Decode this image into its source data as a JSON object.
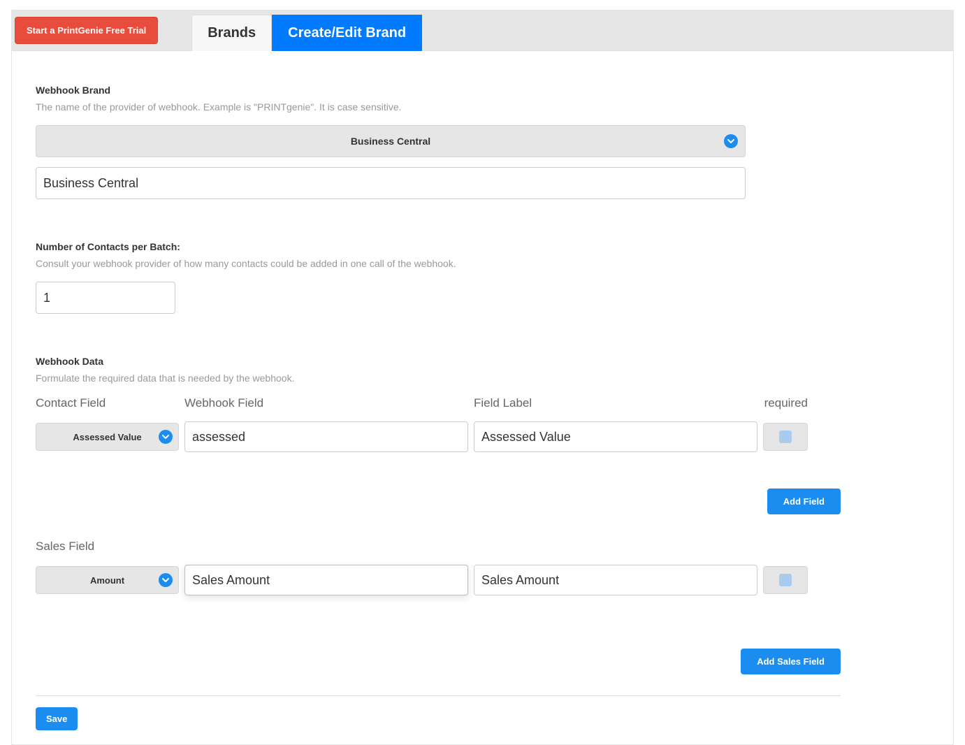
{
  "topbar": {
    "trial_label": "Start a PrintGenie Free Trial",
    "tabs": {
      "brands": "Brands",
      "create_edit": "Create/Edit Brand"
    }
  },
  "sections": {
    "webhook_brand": {
      "title": "Webhook Brand",
      "subtitle": "The name of the provider of webhook. Example is \"PRINTgenie\". It is case sensitive.",
      "select_value": "Business Central",
      "input_value": "Business Central"
    },
    "contacts": {
      "title": "Number of Contacts per Batch:",
      "subtitle": "Consult your webhook provider of how many contacts could be added in one call of the webhook.",
      "value": "1"
    },
    "webhook_data": {
      "title": "Webhook Data",
      "subtitle": "Formulate the required data that is needed by the webhook.",
      "headers": {
        "contact_field": "Contact Field",
        "webhook_field": "Webhook Field",
        "field_label": "Field Label",
        "required": "required"
      },
      "row": {
        "contact_select": "Assessed Value",
        "webhook_value": "assessed",
        "label_value": "Assessed Value"
      },
      "add_field_button": "Add Field"
    },
    "sales": {
      "header": "Sales Field",
      "row": {
        "contact_select": "Amount",
        "webhook_value": "Sales Amount",
        "label_value": "Sales Amount"
      },
      "add_button": "Add Sales Field"
    },
    "save_button": "Save"
  }
}
